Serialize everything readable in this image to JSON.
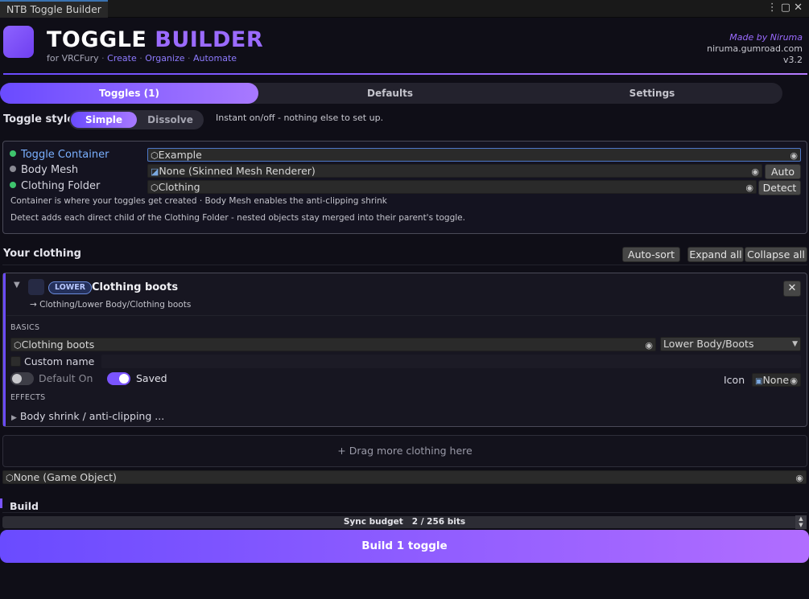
{
  "window": {
    "tab_title": "NTB Toggle Builder",
    "icons": [
      "more-icon",
      "maximize-icon",
      "close-icon"
    ]
  },
  "header": {
    "title_main": "TOGGLE",
    "title_accent": "BUILDER",
    "subtitle": "for VRCFury",
    "links": [
      "Create",
      "Organize",
      "Automate"
    ],
    "made_by": "Made by Niruma",
    "site": "niruma.gumroad.com",
    "version": "v3.2"
  },
  "tabs": [
    {
      "label": "Toggles (1)",
      "active": true
    },
    {
      "label": "Defaults",
      "active": false
    },
    {
      "label": "Settings",
      "active": false
    }
  ],
  "toggle_style": {
    "label": "Toggle style",
    "options": [
      "Simple",
      "Dissolve"
    ],
    "selected": "Simple",
    "description": "Instant on/off - nothing else to set up."
  },
  "setup": {
    "container_label": "Toggle Container",
    "container_value": "Example",
    "body_mesh_label": "Body Mesh",
    "body_mesh_value": "None (Skinned Mesh Renderer)",
    "auto_button": "Auto",
    "clothing_folder_label": "Clothing Folder",
    "clothing_folder_value": "Clothing",
    "detect_button": "Detect",
    "note1": "Container is where your toggles get created  ·  Body Mesh enables the anti-clipping shrink",
    "note2": "Detect adds each direct child of the Clothing Folder - nested objects stay merged into their parent's toggle.",
    "colors": {
      "set": "#3ec46d",
      "unset": "#8a8a94"
    }
  },
  "clothing": {
    "title": "Your clothing",
    "auto_sort": "Auto-sort",
    "expand_all": "Expand all",
    "collapse_all": "Collapse all",
    "item": {
      "badge": "LOWER",
      "name": "Clothing boots",
      "path": "→ Clothing/Lower Body/Clothing boots",
      "basics_label": "BASICS",
      "object_value": "Clothing boots",
      "category": "Lower Body/Boots",
      "custom_name_label": "Custom name",
      "default_on_label": "Default On",
      "saved_label": "Saved",
      "icon_label": "Icon",
      "icon_value": "None",
      "effects_label": "EFFECTS",
      "effect_item": "Body shrink / anti-clipping ..."
    },
    "dropzone": "+   Drag more clothing here",
    "none_object": "None (Game Object)"
  },
  "build": {
    "title": "Build",
    "budget_label": "Sync budget",
    "budget_value": "2 / 256 bits",
    "build_button": "Build 1 toggle"
  },
  "accent": "#7a54ff"
}
